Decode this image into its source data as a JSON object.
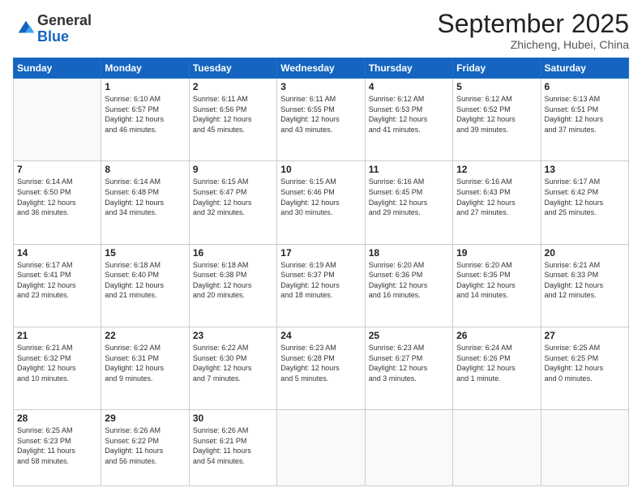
{
  "logo": {
    "general": "General",
    "blue": "Blue"
  },
  "header": {
    "month": "September 2025",
    "location": "Zhicheng, Hubei, China"
  },
  "days_of_week": [
    "Sunday",
    "Monday",
    "Tuesday",
    "Wednesday",
    "Thursday",
    "Friday",
    "Saturday"
  ],
  "weeks": [
    [
      {
        "day": "",
        "info": ""
      },
      {
        "day": "1",
        "info": "Sunrise: 6:10 AM\nSunset: 6:57 PM\nDaylight: 12 hours\nand 46 minutes."
      },
      {
        "day": "2",
        "info": "Sunrise: 6:11 AM\nSunset: 6:56 PM\nDaylight: 12 hours\nand 45 minutes."
      },
      {
        "day": "3",
        "info": "Sunrise: 6:11 AM\nSunset: 6:55 PM\nDaylight: 12 hours\nand 43 minutes."
      },
      {
        "day": "4",
        "info": "Sunrise: 6:12 AM\nSunset: 6:53 PM\nDaylight: 12 hours\nand 41 minutes."
      },
      {
        "day": "5",
        "info": "Sunrise: 6:12 AM\nSunset: 6:52 PM\nDaylight: 12 hours\nand 39 minutes."
      },
      {
        "day": "6",
        "info": "Sunrise: 6:13 AM\nSunset: 6:51 PM\nDaylight: 12 hours\nand 37 minutes."
      }
    ],
    [
      {
        "day": "7",
        "info": "Sunrise: 6:14 AM\nSunset: 6:50 PM\nDaylight: 12 hours\nand 36 minutes."
      },
      {
        "day": "8",
        "info": "Sunrise: 6:14 AM\nSunset: 6:48 PM\nDaylight: 12 hours\nand 34 minutes."
      },
      {
        "day": "9",
        "info": "Sunrise: 6:15 AM\nSunset: 6:47 PM\nDaylight: 12 hours\nand 32 minutes."
      },
      {
        "day": "10",
        "info": "Sunrise: 6:15 AM\nSunset: 6:46 PM\nDaylight: 12 hours\nand 30 minutes."
      },
      {
        "day": "11",
        "info": "Sunrise: 6:16 AM\nSunset: 6:45 PM\nDaylight: 12 hours\nand 29 minutes."
      },
      {
        "day": "12",
        "info": "Sunrise: 6:16 AM\nSunset: 6:43 PM\nDaylight: 12 hours\nand 27 minutes."
      },
      {
        "day": "13",
        "info": "Sunrise: 6:17 AM\nSunset: 6:42 PM\nDaylight: 12 hours\nand 25 minutes."
      }
    ],
    [
      {
        "day": "14",
        "info": "Sunrise: 6:17 AM\nSunset: 6:41 PM\nDaylight: 12 hours\nand 23 minutes."
      },
      {
        "day": "15",
        "info": "Sunrise: 6:18 AM\nSunset: 6:40 PM\nDaylight: 12 hours\nand 21 minutes."
      },
      {
        "day": "16",
        "info": "Sunrise: 6:18 AM\nSunset: 6:38 PM\nDaylight: 12 hours\nand 20 minutes."
      },
      {
        "day": "17",
        "info": "Sunrise: 6:19 AM\nSunset: 6:37 PM\nDaylight: 12 hours\nand 18 minutes."
      },
      {
        "day": "18",
        "info": "Sunrise: 6:20 AM\nSunset: 6:36 PM\nDaylight: 12 hours\nand 16 minutes."
      },
      {
        "day": "19",
        "info": "Sunrise: 6:20 AM\nSunset: 6:35 PM\nDaylight: 12 hours\nand 14 minutes."
      },
      {
        "day": "20",
        "info": "Sunrise: 6:21 AM\nSunset: 6:33 PM\nDaylight: 12 hours\nand 12 minutes."
      }
    ],
    [
      {
        "day": "21",
        "info": "Sunrise: 6:21 AM\nSunset: 6:32 PM\nDaylight: 12 hours\nand 10 minutes."
      },
      {
        "day": "22",
        "info": "Sunrise: 6:22 AM\nSunset: 6:31 PM\nDaylight: 12 hours\nand 9 minutes."
      },
      {
        "day": "23",
        "info": "Sunrise: 6:22 AM\nSunset: 6:30 PM\nDaylight: 12 hours\nand 7 minutes."
      },
      {
        "day": "24",
        "info": "Sunrise: 6:23 AM\nSunset: 6:28 PM\nDaylight: 12 hours\nand 5 minutes."
      },
      {
        "day": "25",
        "info": "Sunrise: 6:23 AM\nSunset: 6:27 PM\nDaylight: 12 hours\nand 3 minutes."
      },
      {
        "day": "26",
        "info": "Sunrise: 6:24 AM\nSunset: 6:26 PM\nDaylight: 12 hours\nand 1 minute."
      },
      {
        "day": "27",
        "info": "Sunrise: 6:25 AM\nSunset: 6:25 PM\nDaylight: 12 hours\nand 0 minutes."
      }
    ],
    [
      {
        "day": "28",
        "info": "Sunrise: 6:25 AM\nSunset: 6:23 PM\nDaylight: 11 hours\nand 58 minutes."
      },
      {
        "day": "29",
        "info": "Sunrise: 6:26 AM\nSunset: 6:22 PM\nDaylight: 11 hours\nand 56 minutes."
      },
      {
        "day": "30",
        "info": "Sunrise: 6:26 AM\nSunset: 6:21 PM\nDaylight: 11 hours\nand 54 minutes."
      },
      {
        "day": "",
        "info": ""
      },
      {
        "day": "",
        "info": ""
      },
      {
        "day": "",
        "info": ""
      },
      {
        "day": "",
        "info": ""
      }
    ]
  ]
}
